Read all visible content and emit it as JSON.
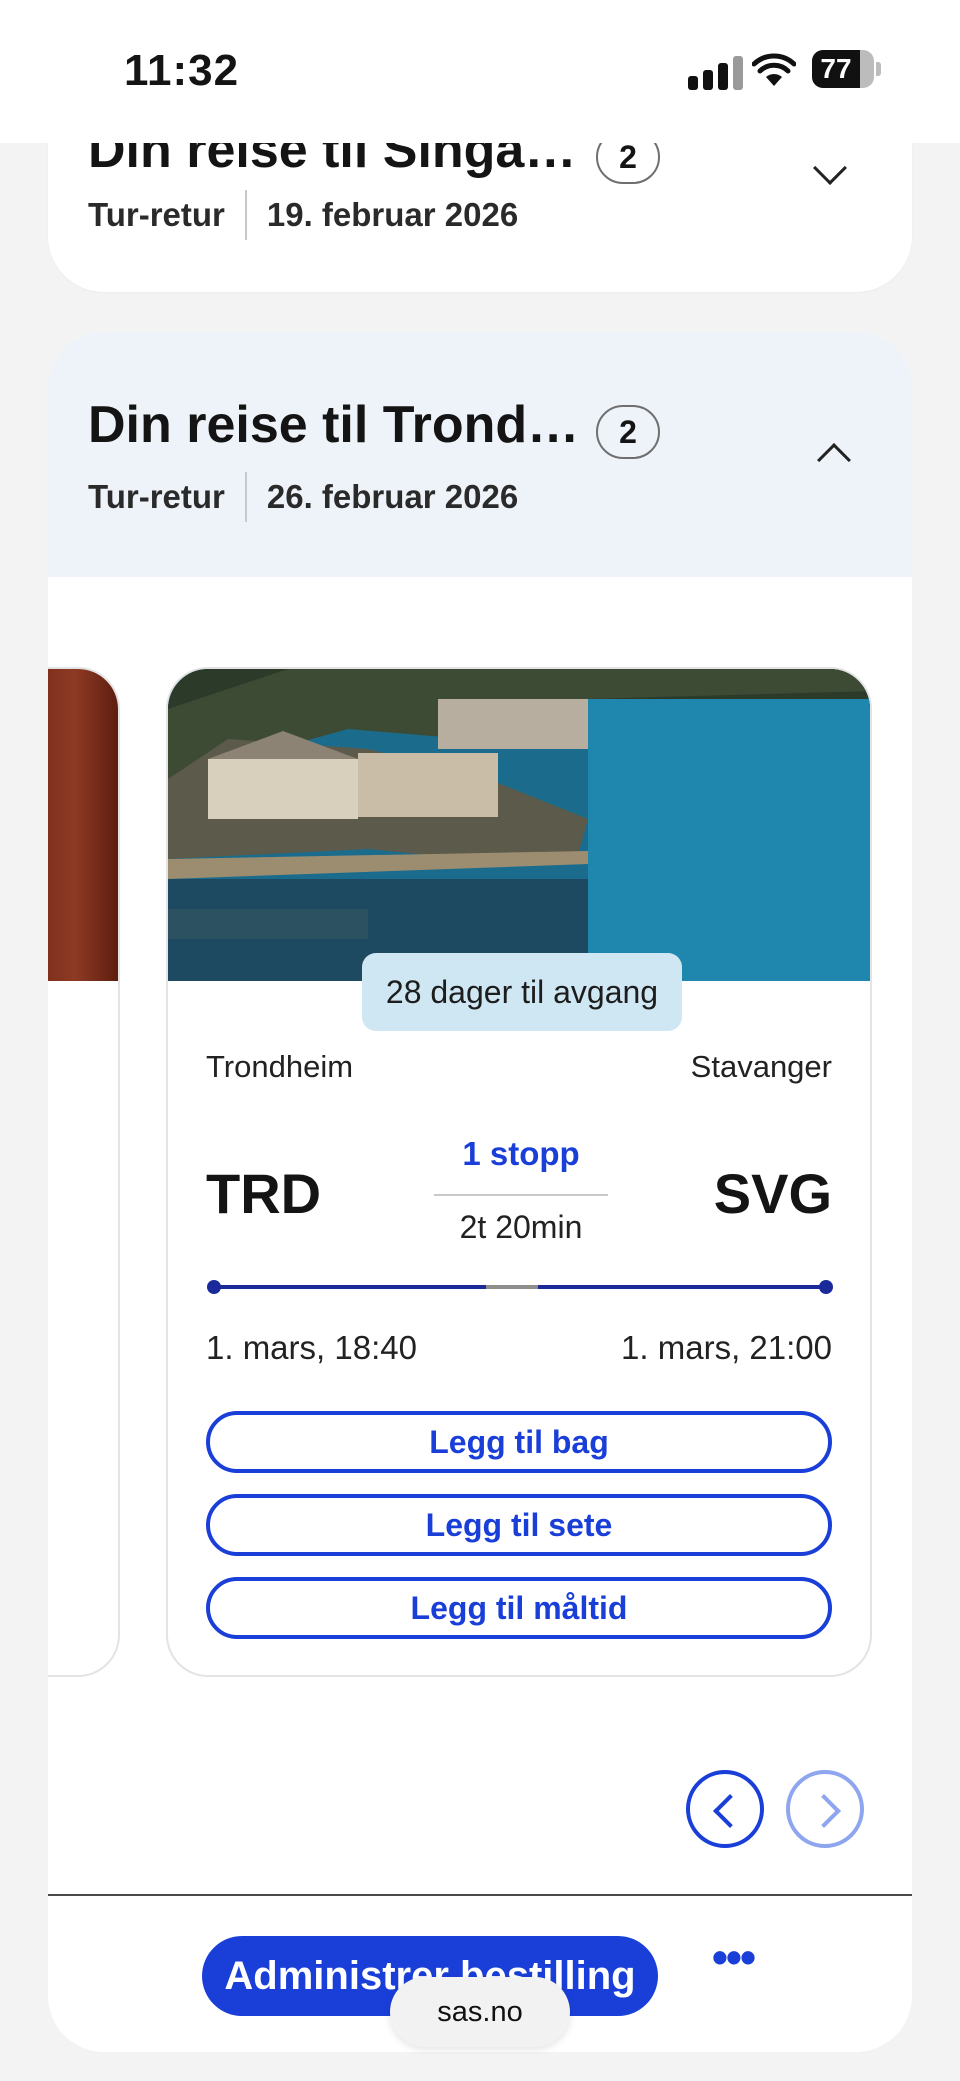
{
  "status_bar": {
    "time": "11:32",
    "battery_level": "77",
    "battery_fraction": 0.77,
    "signal_icon": "cellular-signal-icon",
    "wifi_icon": "wifi-icon"
  },
  "trips": [
    {
      "title": "Din reise til Singa…",
      "passenger_count": "2",
      "trip_type": "Tur-retur",
      "date": "19. februar 2026",
      "expanded": false
    },
    {
      "title": "Din reise til Trond…",
      "passenger_count": "2",
      "trip_type": "Tur-retur",
      "date": "26. februar 2026",
      "expanded": true
    }
  ],
  "flight_card": {
    "days_badge": "28 dager til avgang",
    "from_city": "Trondheim",
    "to_city": "Stavanger",
    "from_code": "TRD",
    "to_code": "SVG",
    "stops": "1 stopp",
    "duration": "2t 20min",
    "departure": "1. mars, 18:40",
    "arrival": "1. mars, 21:00",
    "buttons": {
      "bag": "Legg til bag",
      "seat": "Legg til sete",
      "meal": "Legg til måltid"
    }
  },
  "footer": {
    "primary_action": "Administrer bestilling",
    "more_label": "•••",
    "url": "sas.no"
  },
  "colors": {
    "accent": "#1a3fd9",
    "route_line": "#1b2a9a",
    "header_bg": "#eef3f9",
    "badge_bg": "#cfe6f3"
  }
}
